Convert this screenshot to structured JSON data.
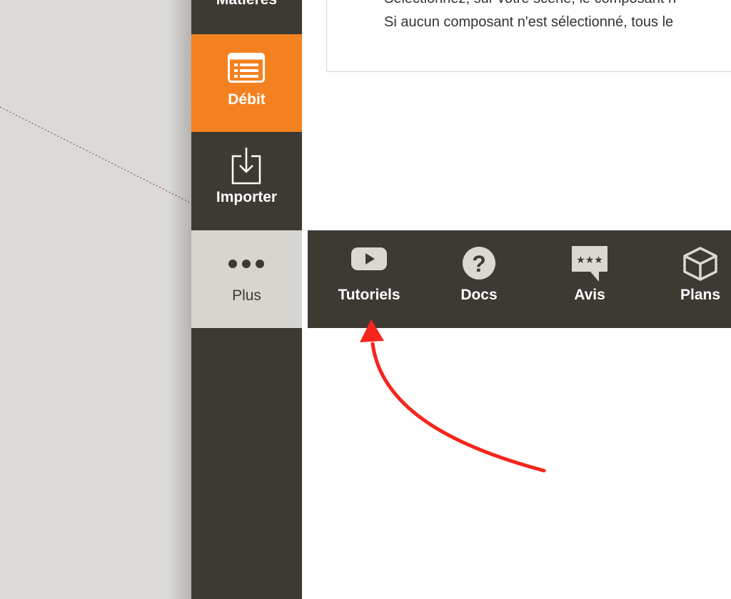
{
  "sidebar": {
    "items": [
      {
        "label": "Matières",
        "icon": "materials-icon"
      },
      {
        "label": "Débit",
        "icon": "cutlist-icon"
      },
      {
        "label": "Importer",
        "icon": "import-icon"
      },
      {
        "label": "Plus",
        "icon": "more-dots-icon"
      }
    ]
  },
  "content": {
    "line1": "Sélectionnez, sur votre scène, le composant n",
    "line2": "Si aucun composant n'est sélectionné, tous le"
  },
  "toolbar": {
    "items": [
      {
        "label": "Tutoriels",
        "icon": "youtube-play-icon"
      },
      {
        "label": "Docs",
        "icon": "question-circle-icon"
      },
      {
        "label": "Avis",
        "icon": "review-stars-bubble-icon"
      },
      {
        "label": "Plans",
        "icon": "cube-icon"
      }
    ]
  },
  "colors": {
    "sidebar_bg": "#3d3a34",
    "active_orange": "#f48120",
    "selected_bg": "#d7d5d0",
    "annotation_red": "#f5251c"
  }
}
